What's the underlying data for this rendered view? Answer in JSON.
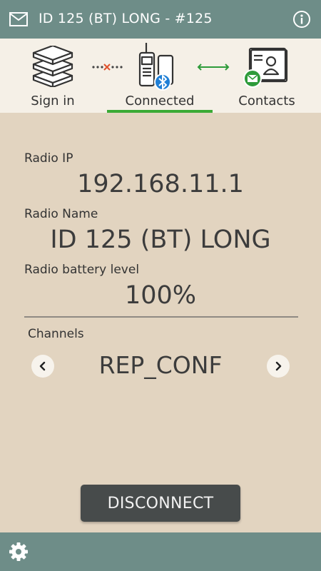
{
  "header": {
    "title": "ID 125 (BT) LONG - #125"
  },
  "steps": [
    {
      "label": "Sign in",
      "icon": "server-stack-icon"
    },
    {
      "label": "Connected",
      "icon": "radio-bluetooth-icon"
    },
    {
      "label": "Contacts",
      "icon": "contact-card-icon"
    }
  ],
  "fields": {
    "ip_label": "Radio IP",
    "ip_value": "192.168.11.1",
    "name_label": "Radio Name",
    "name_value": "ID 125 (BT) LONG",
    "battery_label": "Radio battery level",
    "battery_value": "100%"
  },
  "channels": {
    "label": "Channels",
    "value": "REP_CONF"
  },
  "actions": {
    "disconnect_label": "DISCONNECT"
  },
  "colors": {
    "bar": "#6e8d88",
    "background": "#e2d4c0",
    "tabs_bg": "#f5f0e7",
    "active_underline": "#3aaa35",
    "button": "#474b4b",
    "bluetooth_badge": "#1f7fd6",
    "contacts_badge": "#2e9b3a",
    "disconnected_x": "#e0522d"
  }
}
